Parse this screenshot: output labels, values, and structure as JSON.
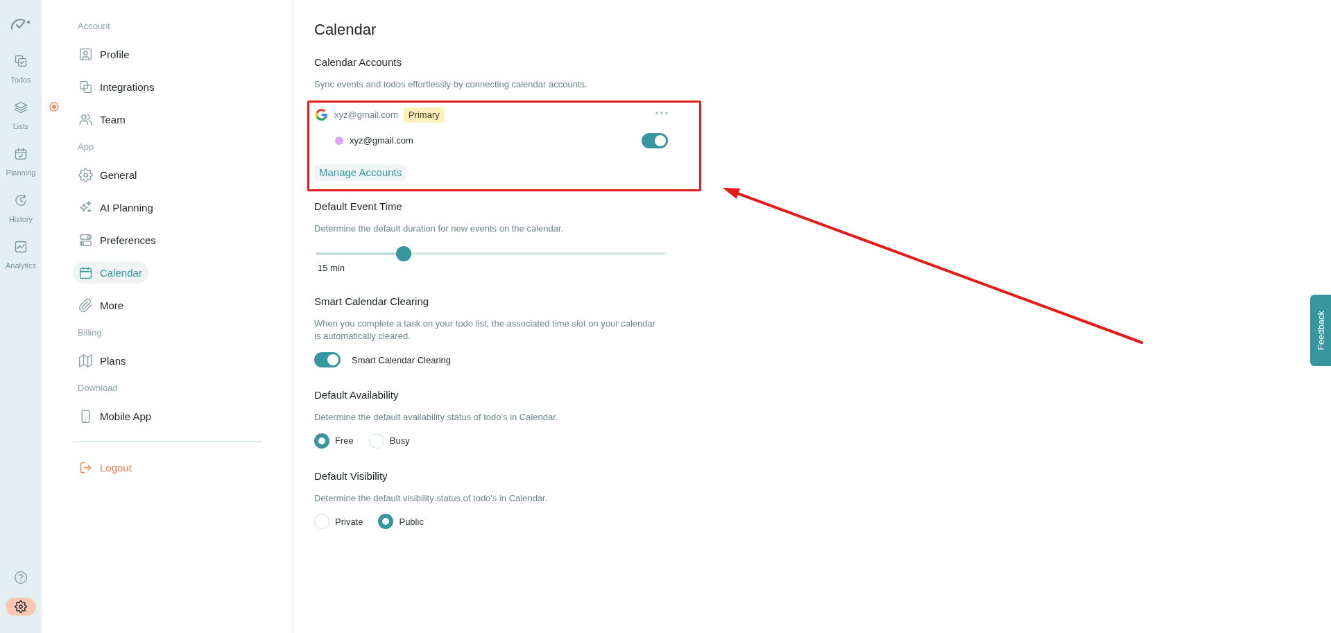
{
  "rail": {
    "items": [
      {
        "label": "Todos",
        "selected": false,
        "indicator": false
      },
      {
        "label": "Lists",
        "selected": false,
        "indicator": true
      },
      {
        "label": "Planning",
        "selected": false,
        "indicator": false
      },
      {
        "label": "History",
        "selected": false,
        "indicator": false
      },
      {
        "label": "Analytics",
        "selected": false,
        "indicator": false
      }
    ],
    "bottom": [
      {
        "kind": "help",
        "selected": false
      },
      {
        "kind": "settings",
        "selected": true
      }
    ]
  },
  "sidebar": {
    "sections": [
      {
        "heading": "Account",
        "items": [
          {
            "label": "Profile",
            "selected": false
          },
          {
            "label": "Integrations",
            "selected": false
          },
          {
            "label": "Team",
            "selected": false
          }
        ]
      },
      {
        "heading": "App",
        "items": [
          {
            "label": "General",
            "selected": false
          },
          {
            "label": "AI Planning",
            "selected": false
          },
          {
            "label": "Preferences",
            "selected": false
          },
          {
            "label": "Calendar",
            "selected": true
          },
          {
            "label": "More",
            "selected": false
          }
        ]
      },
      {
        "heading": "Billing",
        "items": [
          {
            "label": "Plans",
            "selected": false
          }
        ]
      },
      {
        "heading": "Download",
        "items": [
          {
            "label": "Mobile App",
            "selected": false
          }
        ]
      }
    ],
    "logout": {
      "label": "Logout"
    }
  },
  "page": {
    "title": "Calendar",
    "sections": [
      {
        "kind": "accounts",
        "heading": "Calendar Accounts",
        "description": "Sync events and todos effortlessly by connecting calendar accounts.",
        "accounts": [
          {
            "email": "xyz@gmail.com",
            "badge": "Primary",
            "calendars": [
              {
                "name": "xyz@gmail.com",
                "color": "#d9a8f6",
                "on": true
              }
            ]
          }
        ],
        "manage_button": "Manage Accounts"
      },
      {
        "kind": "slider",
        "heading": "Default Event Time",
        "description": "Determine the default duration for new events on the calendar.",
        "level": 0.25,
        "reading": "15 min"
      },
      {
        "kind": "toggle",
        "heading": "Smart Calendar Clearing",
        "description": "When you complete a task on your todo list, the associated time slot on your calendar is automatically cleared.",
        "toggle": {
          "label": "Smart Calendar Clearing",
          "on": true
        }
      },
      {
        "kind": "radio",
        "heading": "Default Availability",
        "description": "Determine the default availability status of todo's in Calendar.",
        "options": [
          {
            "label": "Free",
            "selected": true
          },
          {
            "label": "Busy",
            "selected": false
          }
        ]
      },
      {
        "kind": "radio",
        "heading": "Default Visibility",
        "description": "Determine the default visibility status of todo's in Calendar.",
        "options": [
          {
            "label": "Private",
            "selected": false
          },
          {
            "label": "Public",
            "selected": true
          }
        ]
      }
    ]
  },
  "feedback_tab": {
    "label": "Feedback"
  }
}
